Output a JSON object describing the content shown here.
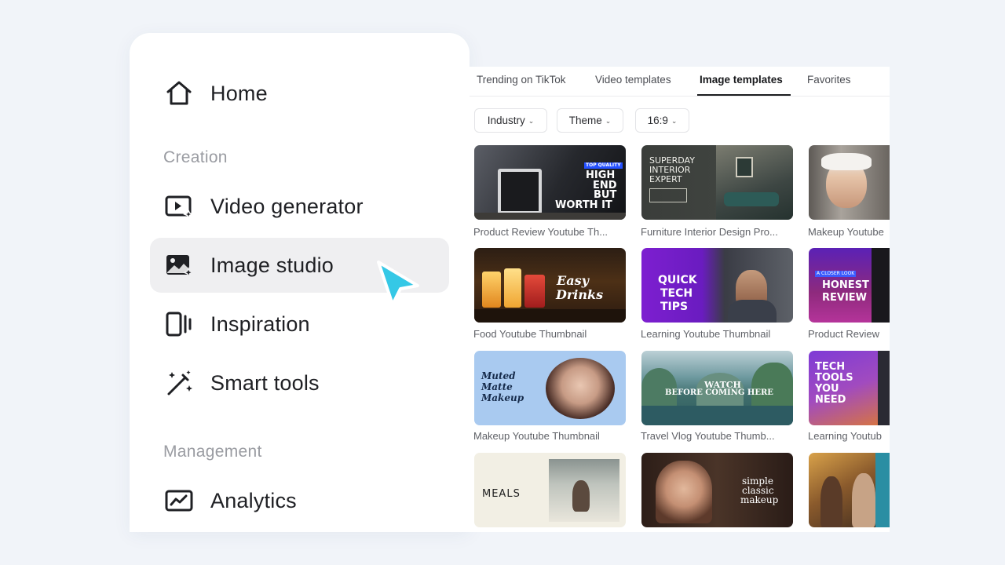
{
  "sidebar": {
    "home_label": "Home",
    "creation_title": "Creation",
    "video_generator_label": "Video generator",
    "image_studio_label": "Image studio",
    "inspiration_label": "Inspiration",
    "smart_tools_label": "Smart tools",
    "management_title": "Management",
    "analytics_label": "Analytics"
  },
  "gallery": {
    "tabs": [
      "Trending on TikTok",
      "Video templates",
      "Image templates",
      "Favorites"
    ],
    "active_tab": "Image templates",
    "filters": [
      "Industry",
      "Theme",
      "16:9"
    ],
    "cards": [
      {
        "label": "Product Review Youtube Th...",
        "thumb": [
          "TOP QUALITY",
          "HIGH",
          "END",
          "BUT",
          "WORTH IT"
        ]
      },
      {
        "label": "Furniture Interior Design Pro...",
        "thumb": [
          "SUPERDAY",
          "INTERIOR",
          "EXPERT"
        ]
      },
      {
        "label": "Makeup Youtube",
        "thumb": []
      },
      {
        "label": "Food Youtube Thumbnail",
        "thumb": [
          "Easy",
          "Drinks"
        ]
      },
      {
        "label": "Learning Youtube Thumbnail",
        "thumb": [
          "QUICK",
          "TECH",
          "TIPS"
        ]
      },
      {
        "label": "Product Review",
        "thumb": [
          "A CLOSER LOOK",
          "HONEST",
          "REVIEW"
        ]
      },
      {
        "label": "Makeup Youtube Thumbnail",
        "thumb": [
          "Muted",
          "Matte",
          "Makeup"
        ]
      },
      {
        "label": "Travel Vlog Youtube Thumb...",
        "thumb": [
          "WATCH",
          "BEFORE COMING HERE"
        ]
      },
      {
        "label": "Learning Youtub",
        "thumb": [
          "TECH",
          "TOOLS",
          "YOU",
          "NEED"
        ]
      },
      {
        "label": "",
        "thumb": [
          "MEALS"
        ]
      },
      {
        "label": "",
        "thumb": [
          "simple",
          "classic",
          "makeup"
        ]
      },
      {
        "label": "",
        "thumb": []
      }
    ]
  },
  "colors": {
    "background": "#f1f4f9",
    "active_item": "#efeff1",
    "cursor": "#35c8e6"
  }
}
